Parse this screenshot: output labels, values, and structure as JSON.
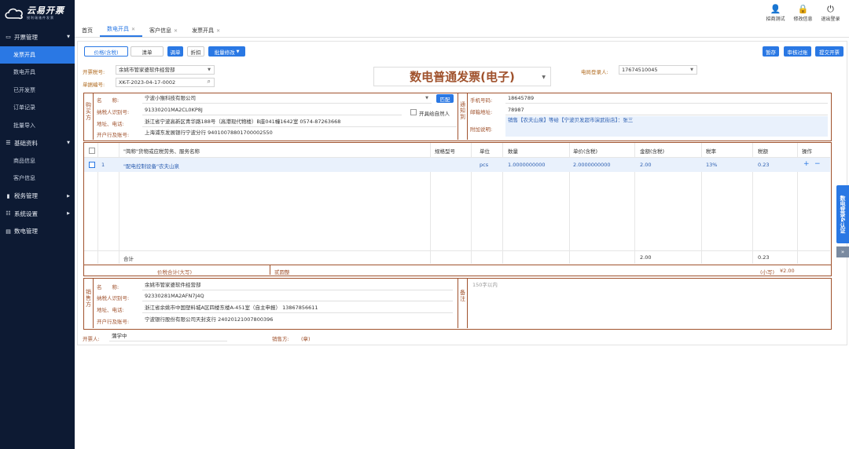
{
  "brand": {
    "name": "云易开票",
    "slogan": "锐利瑞驰件发票",
    "logo_icon": "cloud-logo-icon"
  },
  "sidebar": {
    "groups": [
      {
        "label": "开票管理",
        "icon": "invoice-icon"
      },
      {
        "label": "基础资料",
        "icon": "list-icon"
      },
      {
        "label": "税务管理",
        "icon": "tax-icon"
      },
      {
        "label": "系统设置",
        "icon": "settings-icon"
      },
      {
        "label": "数电管理",
        "icon": "doc-icon"
      }
    ],
    "invoice_items": [
      "发票开具",
      "数电开具",
      "已开发票",
      "订单记录",
      "批量导入"
    ],
    "base_items": [
      "商品信息",
      "客户信息"
    ]
  },
  "top": {
    "icons": [
      {
        "label": "招商测试",
        "icon": "user-icon"
      },
      {
        "label": "修改信息",
        "icon": "lock-icon"
      },
      {
        "label": "退出登录",
        "icon": "power-icon"
      }
    ]
  },
  "tabs": [
    {
      "label": "首页",
      "closable": false
    },
    {
      "label": "数电开具",
      "closable": true
    },
    {
      "label": "客户信息",
      "closable": true
    },
    {
      "label": "发票开具",
      "closable": true
    }
  ],
  "toolbar": {
    "price_tax": "价格(含税)",
    "list": "清单",
    "discount_single": "调单",
    "discount": "折扣",
    "batch": "批量修改",
    "save": "暂存",
    "review": "审核过账",
    "submit": "提交开票"
  },
  "header": {
    "tax_label": "开票税号:",
    "tax_value": "余姚市管家婆软件经营部",
    "doc_label": "单据编号:",
    "doc_value": "XK-T-2023-04-17-0002",
    "title": "数电普通发票(电子)",
    "login_label": "电局登录人:",
    "login_value": "17674510045"
  },
  "buyer": {
    "side": "购买方",
    "name_key": "名　　称:",
    "name_value": "宁波小猴科技有限公司",
    "match": "匹配",
    "natural": "开具给自然人",
    "tax_key": "纳税人识别号:",
    "tax_value": "91330201MA2CL0KP8J",
    "addr_key": "地址、电话:",
    "addr_value": "浙江省宁波高新区青华路188号（高港现代物楼）B座041幢1642室 0574-87263668",
    "bank_key": "开户行及账号:",
    "bank_value": "上海浦东发展银行宁波分行 94010078801700002550"
  },
  "notify": {
    "side": "通知到",
    "phone_key": "手机号码:",
    "phone_value": "18645789",
    "email_key": "邮箱地址:",
    "email_value": "78987",
    "note_key": "附加说明:",
    "note_value": "销售【农夫山泉】等给【宁波贝发超市演武街店】：张三"
  },
  "grid": {
    "headers": [
      "\"简称\"货物或应税劳务、服务名称",
      "规格型号",
      "单位",
      "数量",
      "单价(含税)",
      "金额(含税)",
      "税率",
      "税额",
      "操作"
    ],
    "rows": [
      {
        "no": "1",
        "name": "\"配电控制设备\"农夫山泉",
        "spec": "",
        "unit": "pcs",
        "qty": "1.0000000000",
        "price": "2.0000000000",
        "amount": "2.00",
        "rate": "13%",
        "tax": "0.23"
      }
    ],
    "total_label": "合计",
    "total_amount": "2.00",
    "total_tax": "0.23",
    "caps_label": "价税合计(大写)",
    "caps_value": "贰圆整",
    "small_label": "(小写)",
    "small_value": "¥2.00",
    "add": "+",
    "remove": "−"
  },
  "seller": {
    "side": "销售方",
    "name_key": "名　　称:",
    "name_value": "余姚市管家婆软件经营部",
    "tax_key": "纳税人识别号:",
    "tax_value": "92330281MA2AFN7J4Q",
    "addr_key": "地址、电话:",
    "addr_value": "浙江省余姚市中国塑料城A区四楼东楼A-451室（自主申报） 13867856611",
    "bank_key": "开户行及账号:",
    "bank_value": "宁波银行股份有限公司天封支行 240201210078003​96"
  },
  "remark": {
    "side": "备注",
    "placeholder": "150字以内"
  },
  "footer": {
    "drawer_label": "开票人:",
    "drawer_value": "蒲学中",
    "seller_label": "销售方:",
    "seller_value": "(章)"
  },
  "rightdock": {
    "label": "数电登录&认证",
    "collapse": "»"
  }
}
